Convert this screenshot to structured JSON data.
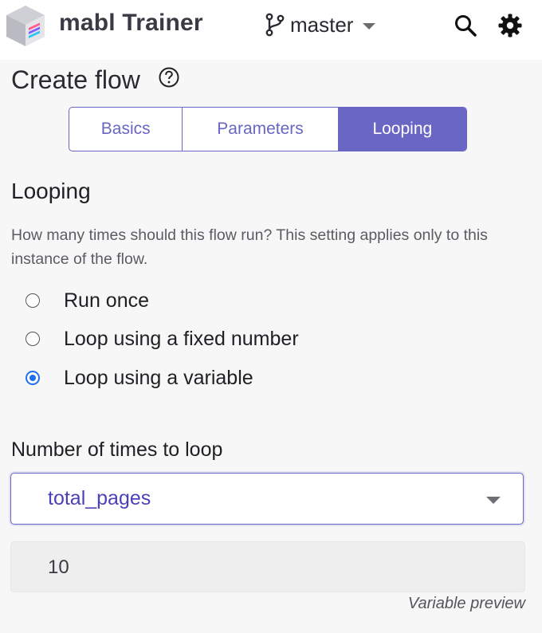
{
  "header": {
    "app_name": "mabl Trainer",
    "branch": "master",
    "icons": [
      "mabl-logo-icon",
      "git-branch-icon",
      "chevron-down-icon",
      "search-icon",
      "gear-icon"
    ]
  },
  "page": {
    "title": "Create flow",
    "help_icon": "help-circle-icon"
  },
  "tabs": [
    {
      "label": "Basics",
      "active": false
    },
    {
      "label": "Parameters",
      "active": false
    },
    {
      "label": "Looping",
      "active": true
    }
  ],
  "looping": {
    "title": "Looping",
    "description": "How many times should this flow run? This setting applies only to this instance of the flow.",
    "options": [
      {
        "label": "Run once",
        "checked": false
      },
      {
        "label": "Loop using a fixed number",
        "checked": false
      },
      {
        "label": "Loop using a variable",
        "checked": true
      }
    ]
  },
  "loop_count": {
    "label": "Number of times to loop",
    "selected_variable": "total_pages",
    "preview_value": "10",
    "preview_caption": "Variable preview"
  },
  "colors": {
    "accent": "#6a66c4",
    "radio_checked": "#1f6ff0",
    "background": "#f7f7f8"
  }
}
